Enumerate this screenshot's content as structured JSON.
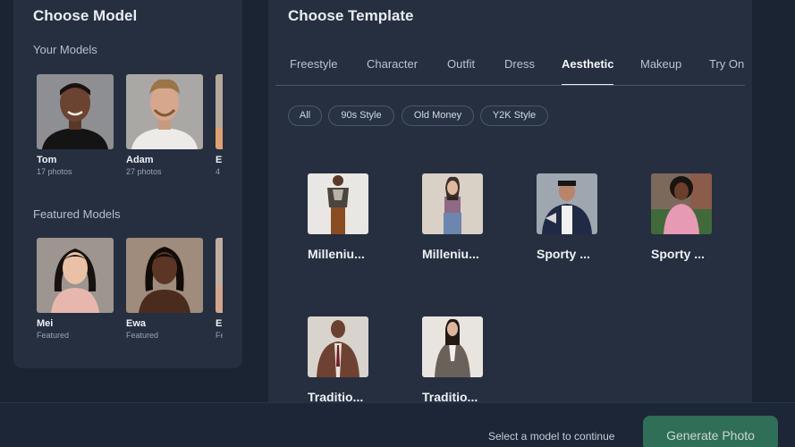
{
  "left": {
    "title": "Choose Model",
    "your_models_label": "Your Models",
    "your_models": [
      {
        "name": "Tom",
        "sub": "17 photos"
      },
      {
        "name": "Adam",
        "sub": "27 photos"
      },
      {
        "name": "E",
        "sub": "4"
      }
    ],
    "featured_label": "Featured Models",
    "featured": [
      {
        "name": "Mei",
        "sub": "Featured"
      },
      {
        "name": "Ewa",
        "sub": "Featured"
      },
      {
        "name": "E",
        "sub": "Fe"
      }
    ]
  },
  "right": {
    "title": "Choose Template",
    "tabs": [
      "Freestyle",
      "Character",
      "Outfit",
      "Dress",
      "Aesthetic",
      "Makeup",
      "Try On"
    ],
    "active_tab": "Aesthetic",
    "chips": [
      "All",
      "90s Style",
      "Old Money",
      "Y2K Style"
    ],
    "templates": [
      {
        "name": "Milleniu..."
      },
      {
        "name": "Milleniu..."
      },
      {
        "name": "Sporty ..."
      },
      {
        "name": "Sporty ..."
      },
      {
        "name": "Traditio..."
      },
      {
        "name": "Traditio..."
      }
    ]
  },
  "footer": {
    "hint": "Select a model to continue",
    "generate_label": "Generate Photo"
  },
  "colors": {
    "background": "#1b2433",
    "panel": "#252f3f",
    "accent_button": "#2f6e57"
  }
}
